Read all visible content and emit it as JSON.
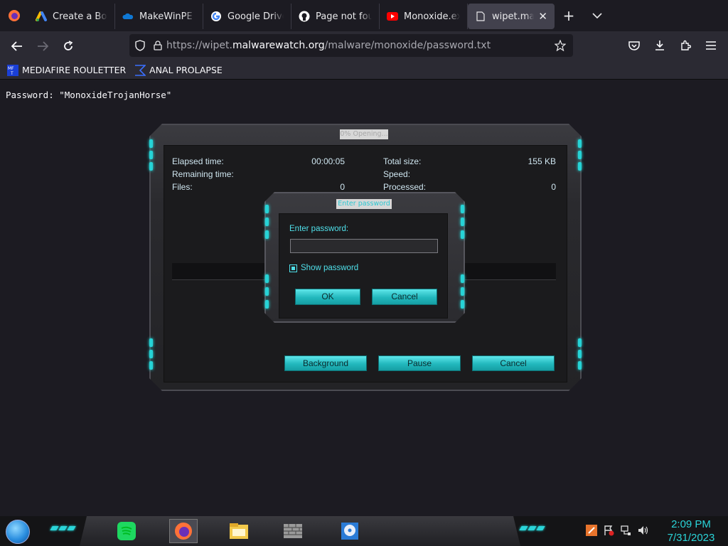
{
  "browser": {
    "tabs": [
      {
        "title": "Create a Bootab",
        "icon": "google-ads-icon"
      },
      {
        "title": "MakeWinPE - O",
        "icon": "onedrive-icon"
      },
      {
        "title": "Google Drive: Si",
        "icon": "google-icon"
      },
      {
        "title": "Page not found",
        "icon": "github-icon"
      },
      {
        "title": "Monoxide.exe",
        "icon": "youtube-icon"
      },
      {
        "title": "wipet.malwa",
        "icon": "document-icon",
        "active": true
      }
    ],
    "url_prefix": "https://wipet.",
    "url_domain": "malwarewatch.org",
    "url_path": "/malware/monoxide/password.txt",
    "bookmarks": [
      {
        "label": "MEDIAFIRE ROULETTER",
        "icon": "mediafire-icon"
      },
      {
        "label": "ANAL PROLAPSE",
        "icon": "bookmark-folder-icon"
      }
    ]
  },
  "page": {
    "text": "Password: \"MonoxideTrojanHorse\""
  },
  "monoxide": {
    "title": "0% Opening...",
    "elapsed_label": "Elapsed time:",
    "elapsed_value": "00:00:05",
    "remaining_label": "Remaining time:",
    "files_label": "Files:",
    "files_value": "0",
    "total_size_label": "Total size:",
    "total_size_value": "155 KB",
    "speed_label": "Speed:",
    "processed_label": "Processed:",
    "processed_value": "0",
    "progress": 0,
    "buttons": {
      "background": "Background",
      "pause": "Pause",
      "cancel": "Cancel"
    }
  },
  "password_dialog": {
    "title": "Enter password",
    "prompt": "Enter password:",
    "value": "",
    "show_password_label": "Show password",
    "show_password_checked": true,
    "ok": "OK",
    "cancel": "Cancel"
  },
  "taskbar": {
    "apps": [
      "spotify-icon",
      "firefox-icon",
      "file-explorer-icon",
      "firewall-icon",
      "disk-icon"
    ],
    "time": "2:09 PM",
    "date": "7/31/2023"
  },
  "colors": {
    "accent": "#26d3d6",
    "clock": "#2ad4d8"
  }
}
